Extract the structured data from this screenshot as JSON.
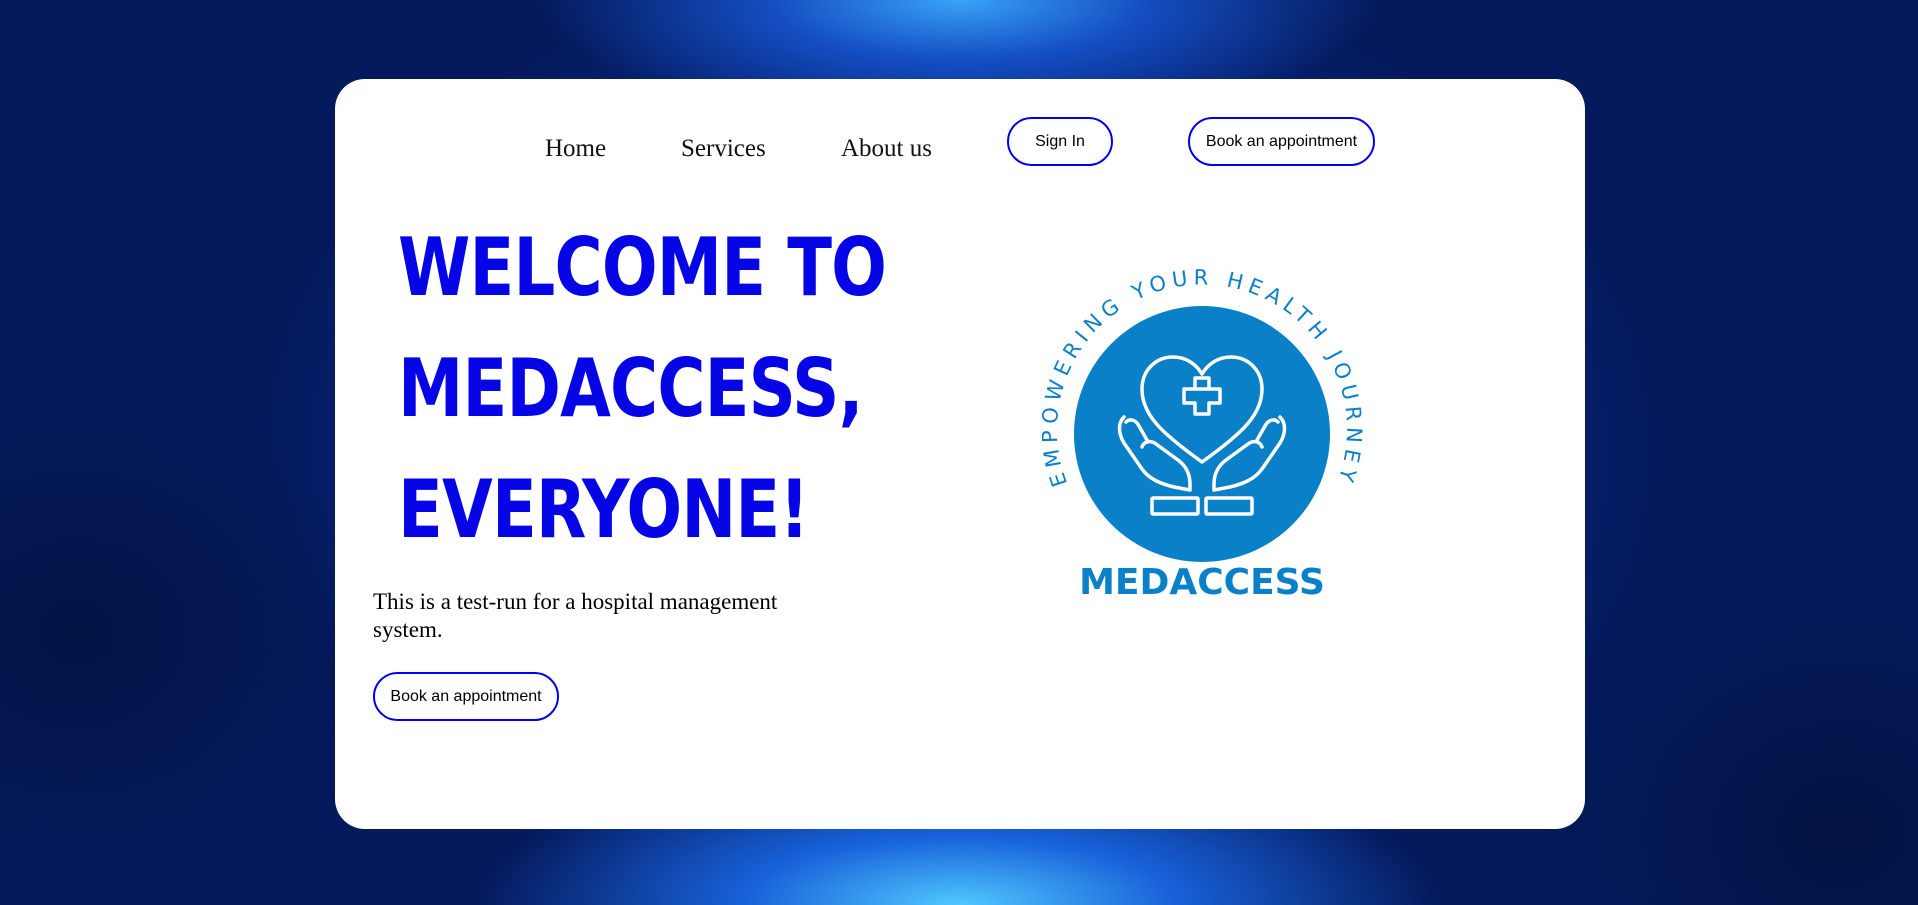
{
  "nav": {
    "home": "Home",
    "services": "Services",
    "about": "About us",
    "sign_in": "Sign In",
    "book": "Book an appointment"
  },
  "hero": {
    "line1": "WELCOME TO",
    "line2": "MEDACCESS,",
    "line3": "EVERYONE!",
    "intro": "This is a test-run for a hospital management system.",
    "book": "Book an appointment"
  },
  "logo": {
    "arc_text": "EMPOWERING YOUR HEALTH JOURNEY",
    "wordmark": "MEDACCESS",
    "icon": "heart-hands-cross-icon"
  },
  "colors": {
    "accent": "#0505e6",
    "logo_blue": "#0a80c8",
    "card": "#ffffff",
    "background": "#072a8a"
  }
}
